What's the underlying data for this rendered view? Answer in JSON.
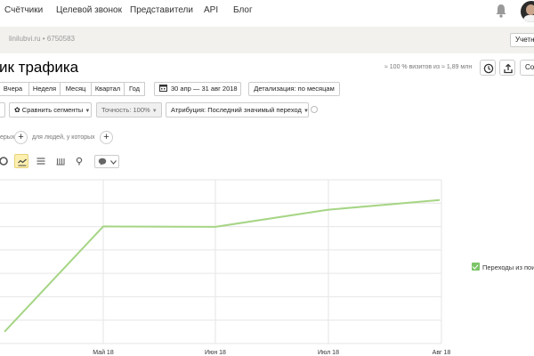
{
  "topnav": {
    "items": [
      {
        "label": "Счётчики"
      },
      {
        "label": "Целевой звонок"
      },
      {
        "label": "Представители"
      },
      {
        "label": "API"
      },
      {
        "label": "Блог"
      }
    ]
  },
  "counter": {
    "site": "linilubvi.ru • 6750583",
    "account_label": "Учетн"
  },
  "report": {
    "title": "ик трафика",
    "visits_note": "≈ 100 % визитов из ≈ 1,89 млн",
    "save_label": "Сох"
  },
  "period": {
    "presets": [
      "Вчера",
      "Неделя",
      "Месяц",
      "Квартал",
      "Год"
    ],
    "date_range": "30 апр — 31 авг 2018",
    "detail": "Детализация: по месяцам"
  },
  "segments": {
    "compare": "Сравнить сегменты",
    "accuracy": "Точность: 100%",
    "attribution": "Атрибуция: Последний значимый переход"
  },
  "filters": {
    "left_text": "ерых",
    "people_text": "для людей, у которых"
  },
  "chart_data": {
    "type": "line",
    "categories": [
      "Май 18",
      "Июн 18",
      "Июл 18",
      "Авг 18"
    ],
    "series": [
      {
        "name": "Переходы из поис",
        "color": "#a6d585",
        "values": [
          null,
          null,
          null,
          null
        ]
      }
    ],
    "x": [
      0,
      1,
      2,
      3,
      4,
      5
    ],
    "points": [
      {
        "x": -0.88,
        "y": 0.52
      },
      {
        "x": 0.0,
        "y": 5.15
      },
      {
        "x": 1.0,
        "y": 5.13
      },
      {
        "x": 2.0,
        "y": 5.88
      },
      {
        "x": 3.0,
        "y": 6.31
      }
    ],
    "ylim": [
      0,
      7.2
    ],
    "grid": true,
    "legend": "right"
  },
  "legend": {
    "label": "Переходы из поис",
    "color": "#7cc468"
  }
}
